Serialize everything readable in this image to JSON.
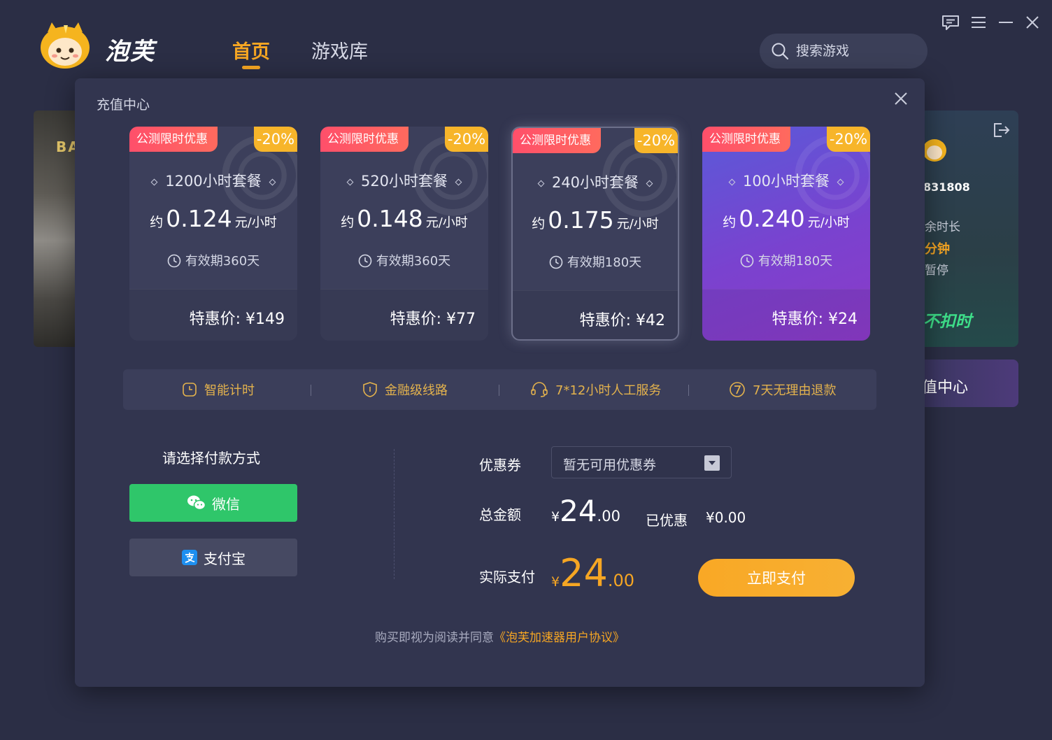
{
  "app": {
    "brand": "泡芙",
    "nav": {
      "home": "首页",
      "library": "游戏库"
    },
    "search_placeholder": "搜索游戏"
  },
  "background": {
    "game_text": "BA",
    "user_id": "831808",
    "line1": "余时长",
    "line2": "分钟",
    "line3": "暂停",
    "line4": "不扣时",
    "recharge": "值中心"
  },
  "modal": {
    "title": "充值中心",
    "plans": [
      {
        "promo": "公测限时优惠",
        "discount": "-20%",
        "name": "1200小时套餐",
        "rate_prefix": "约",
        "rate": "0.124",
        "rate_unit": "元/小时",
        "validity": "有效期360天",
        "price_label": "特惠价: ",
        "price": "¥149"
      },
      {
        "promo": "公测限时优惠",
        "discount": "-20%",
        "name": "520小时套餐",
        "rate_prefix": "约",
        "rate": "0.148",
        "rate_unit": "元/小时",
        "validity": "有效期360天",
        "price_label": "特惠价: ",
        "price": "¥77"
      },
      {
        "promo": "公测限时优惠",
        "discount": "-20%",
        "name": "240小时套餐",
        "rate_prefix": "约",
        "rate": "0.175",
        "rate_unit": "元/小时",
        "validity": "有效期180天",
        "price_label": "特惠价: ",
        "price": "¥42"
      },
      {
        "promo": "公测限时优惠",
        "discount": "-20%",
        "name": "100小时套餐",
        "rate_prefix": "约",
        "rate": "0.240",
        "rate_unit": "元/小时",
        "validity": "有效期180天",
        "price_label": "特惠价: ",
        "price": "¥24"
      }
    ],
    "features": [
      "智能计时",
      "金融级线路",
      "7*12小时人工服务",
      "7天无理由退款"
    ],
    "payment": {
      "label": "请选择付款方式",
      "wechat": "微信",
      "alipay": "支付宝"
    },
    "order": {
      "coupon_label": "优惠券",
      "coupon_value": "暂无可用优惠券",
      "total_label": "总金额",
      "currency": "¥",
      "total_int": "24",
      "total_dec": ".00",
      "saved_label": "已优惠",
      "saved_amount": "¥0.00",
      "actual_label": "实际支付",
      "actual_int": "24",
      "actual_dec": ".00",
      "pay_button": "立即支付"
    },
    "agreement": {
      "text": "购买即视为阅读并同意",
      "link": "《泡芙加速器用户协议》"
    }
  },
  "colors": {
    "accent": "#f6a623",
    "wechat": "#2fc66a",
    "promo": "#ff4f6a",
    "discount": "#f7b52a",
    "feature_text": "#e3b24d"
  },
  "icons": {
    "window": [
      "feedback-icon",
      "menu-icon",
      "minimize-icon",
      "close-icon"
    ],
    "features": [
      "clock-icon",
      "shield-icon",
      "headset-icon",
      "seven-days-icon"
    ]
  }
}
